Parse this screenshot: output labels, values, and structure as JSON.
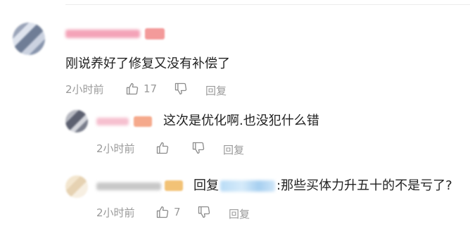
{
  "comments": [
    {
      "text": "刚说养好了修复又没有补偿了",
      "time": "2小时前",
      "likes": "17",
      "reply_label": "回复",
      "name_color": "#f4a3b8",
      "badge_color": "#f39a9a"
    },
    {
      "text": "这次是优化啊.也没犯什么错",
      "time": "2小时前",
      "likes": "",
      "reply_label": "回复",
      "name_color": "#f6c0cf",
      "badge_color": "#f5a98c"
    },
    {
      "reply_prefix": "回复",
      "text": ":那些买体力升五十的不是亏了?",
      "time": "2小时前",
      "likes": "7",
      "reply_label": "回复",
      "name_color": "#c8c8c8",
      "badge_color": "#f2c276",
      "mention_color": "#b9dcf6"
    }
  ],
  "icons": {
    "like": "thumbs-up-icon",
    "dislike": "thumbs-down-icon"
  }
}
